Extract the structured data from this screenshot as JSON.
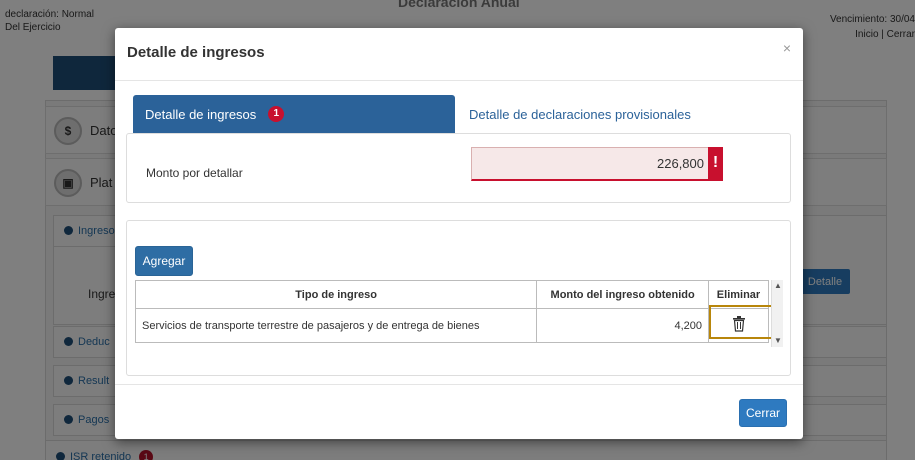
{
  "background": {
    "top_left": [
      "declaración: Normal",
      "Del Ejercicio"
    ],
    "title": "Declaración Anual",
    "vencimiento": "Vencimiento: 30/04",
    "links": "Inicio | Cerrar",
    "sections": [
      {
        "icon": "$",
        "label": "Dato"
      },
      {
        "icon": "▣",
        "label": "Plat"
      }
    ],
    "accordion": [
      "Ingreso",
      "Deduc",
      "Result",
      "Pagos",
      "ISR retenido"
    ],
    "ingresos_label": "Ingres",
    "detalle_button": "Detalle",
    "isr_badge": "1"
  },
  "modal": {
    "title": "Detalle de ingresos",
    "close": "×",
    "tabs": [
      {
        "label": "Detalle de ingresos",
        "badge": "1",
        "active": true
      },
      {
        "label": "Detalle de declaraciones provisionales",
        "active": false
      }
    ],
    "monto_label": "Monto por detallar",
    "monto_value": "226,800",
    "monto_alert": "!",
    "agregar_label": "Agregar",
    "table": {
      "headers": [
        "Tipo de ingreso",
        "Monto del ingreso obtenido",
        "Eliminar"
      ],
      "rows": [
        {
          "tipo": "Servicios de transporte terrestre de pasajeros y de entrega de bienes",
          "monto": "4,200"
        }
      ]
    },
    "cerrar_label": "Cerrar"
  },
  "colors": {
    "tab_active": "#2b6299",
    "alert_red": "#c8102e",
    "highlight": "#b8860b",
    "button_blue": "#2e7ac0"
  }
}
